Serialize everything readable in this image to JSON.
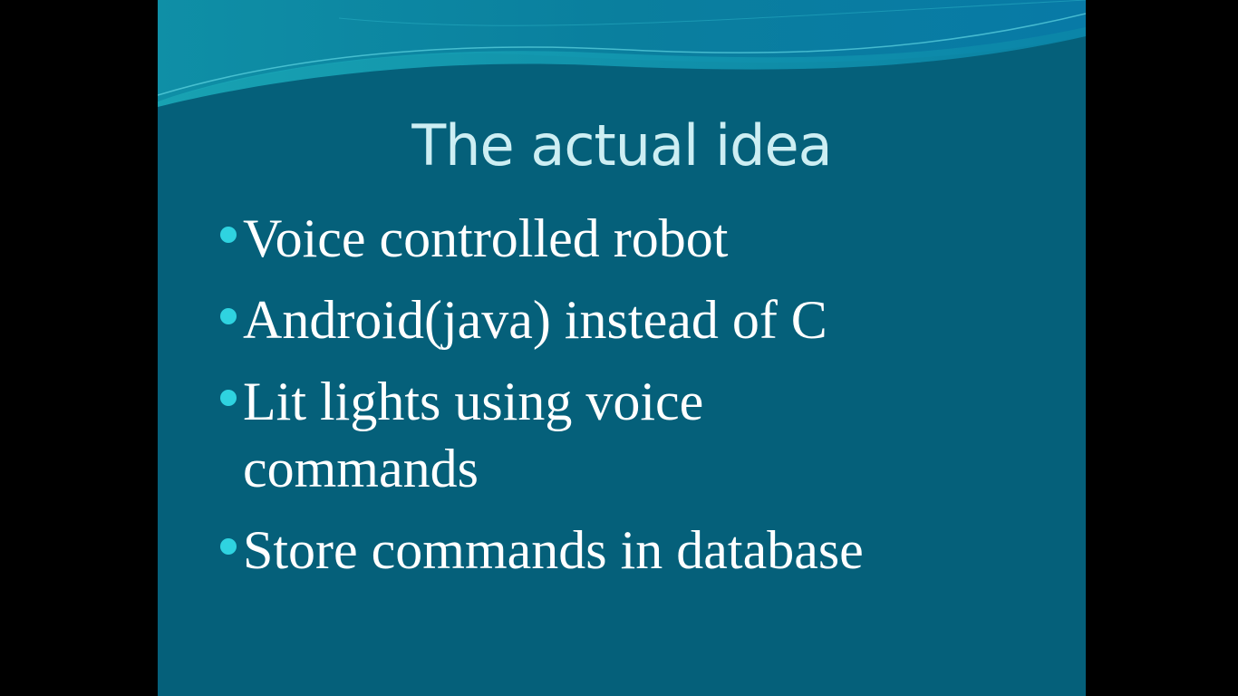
{
  "slide": {
    "title": "The actual idea",
    "bullets": [
      "Voice controlled robot",
      "Android(java) instead of C",
      "Lit lights using voice commands",
      "Store commands in database"
    ]
  },
  "colors": {
    "background": "#05607a",
    "title_text": "#cdeef3",
    "bullet_text": "#ffffff",
    "bullet_marker": "#2fd3e0",
    "letterbox": "#000000"
  }
}
